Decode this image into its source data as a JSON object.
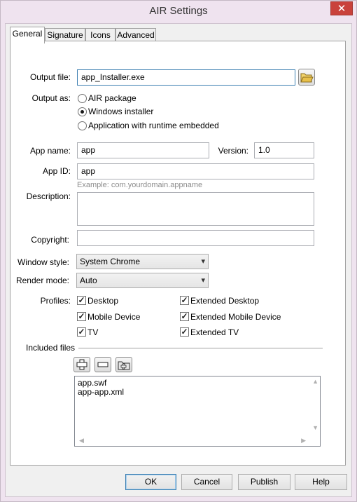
{
  "window": {
    "title": "AIR Settings",
    "close_glyph": "✕"
  },
  "tabs": [
    {
      "label": "General",
      "active": true
    },
    {
      "label": "Signature",
      "active": false
    },
    {
      "label": "Icons",
      "active": false
    },
    {
      "label": "Advanced",
      "active": false
    }
  ],
  "general": {
    "output_file": {
      "label": "Output file:",
      "value": "app_Installer.exe",
      "browse_icon": "folder-open-icon"
    },
    "output_as": {
      "label": "Output as:",
      "options": [
        {
          "label": "AIR package",
          "selected": false
        },
        {
          "label": "Windows installer",
          "selected": true
        },
        {
          "label": "Application with runtime embedded",
          "selected": false
        }
      ]
    },
    "app_name": {
      "label": "App name:",
      "value": "app"
    },
    "version": {
      "label": "Version:",
      "value": "1.0"
    },
    "app_id": {
      "label": "App ID:",
      "value": "app",
      "hint": "Example: com.yourdomain.appname"
    },
    "description": {
      "label": "Description:",
      "value": ""
    },
    "copyright": {
      "label": "Copyright:",
      "value": ""
    },
    "window_style": {
      "label": "Window style:",
      "value": "System Chrome"
    },
    "render_mode": {
      "label": "Render mode:",
      "value": "Auto"
    },
    "profiles": {
      "label": "Profiles:",
      "items": [
        {
          "label": "Desktop",
          "checked": true
        },
        {
          "label": "Extended Desktop",
          "checked": true
        },
        {
          "label": "Mobile Device",
          "checked": true
        },
        {
          "label": "Extended Mobile Device",
          "checked": true
        },
        {
          "label": "TV",
          "checked": true
        },
        {
          "label": "Extended TV",
          "checked": true
        }
      ]
    },
    "included_files": {
      "label": "Included files",
      "buttons": [
        "add-icon",
        "remove-icon",
        "add-folder-icon"
      ],
      "files": [
        "app.swf",
        "app-app.xml"
      ]
    }
  },
  "footer": {
    "ok": "OK",
    "cancel": "Cancel",
    "publish": "Publish",
    "help": "Help"
  },
  "colors": {
    "close_button": "#c9423b",
    "focus_border": "#3c7fb1",
    "window_frame": "#efe3ef"
  }
}
